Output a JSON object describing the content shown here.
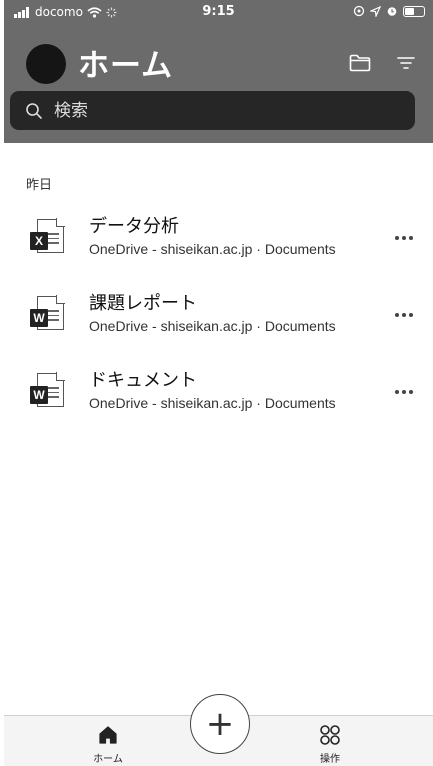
{
  "status_bar": {
    "carrier": "docomo",
    "time": "9:15"
  },
  "header": {
    "title": "ホーム"
  },
  "search": {
    "placeholder": "検索"
  },
  "section": {
    "label": "昨日"
  },
  "files": [
    {
      "name": "データ分析",
      "location": "OneDrive - shiseikan.ac.jp · Documents",
      "type": "excel",
      "badge": "X"
    },
    {
      "name": "課題レポート",
      "location": "OneDrive - shiseikan.ac.jp · Documents",
      "type": "word",
      "badge": "W"
    },
    {
      "name": "ドキュメント",
      "location": "OneDrive - shiseikan.ac.jp · Documents",
      "type": "word",
      "badge": "W"
    }
  ],
  "tab_bar": {
    "home_label": "ホーム",
    "actions_label": "操作",
    "create_symbol": "+"
  },
  "icons": [
    "search-icon",
    "folder-icon",
    "filter-icon",
    "more-icon",
    "home-icon",
    "actions-icon",
    "plus-icon",
    "excel-icon",
    "word-icon"
  ]
}
